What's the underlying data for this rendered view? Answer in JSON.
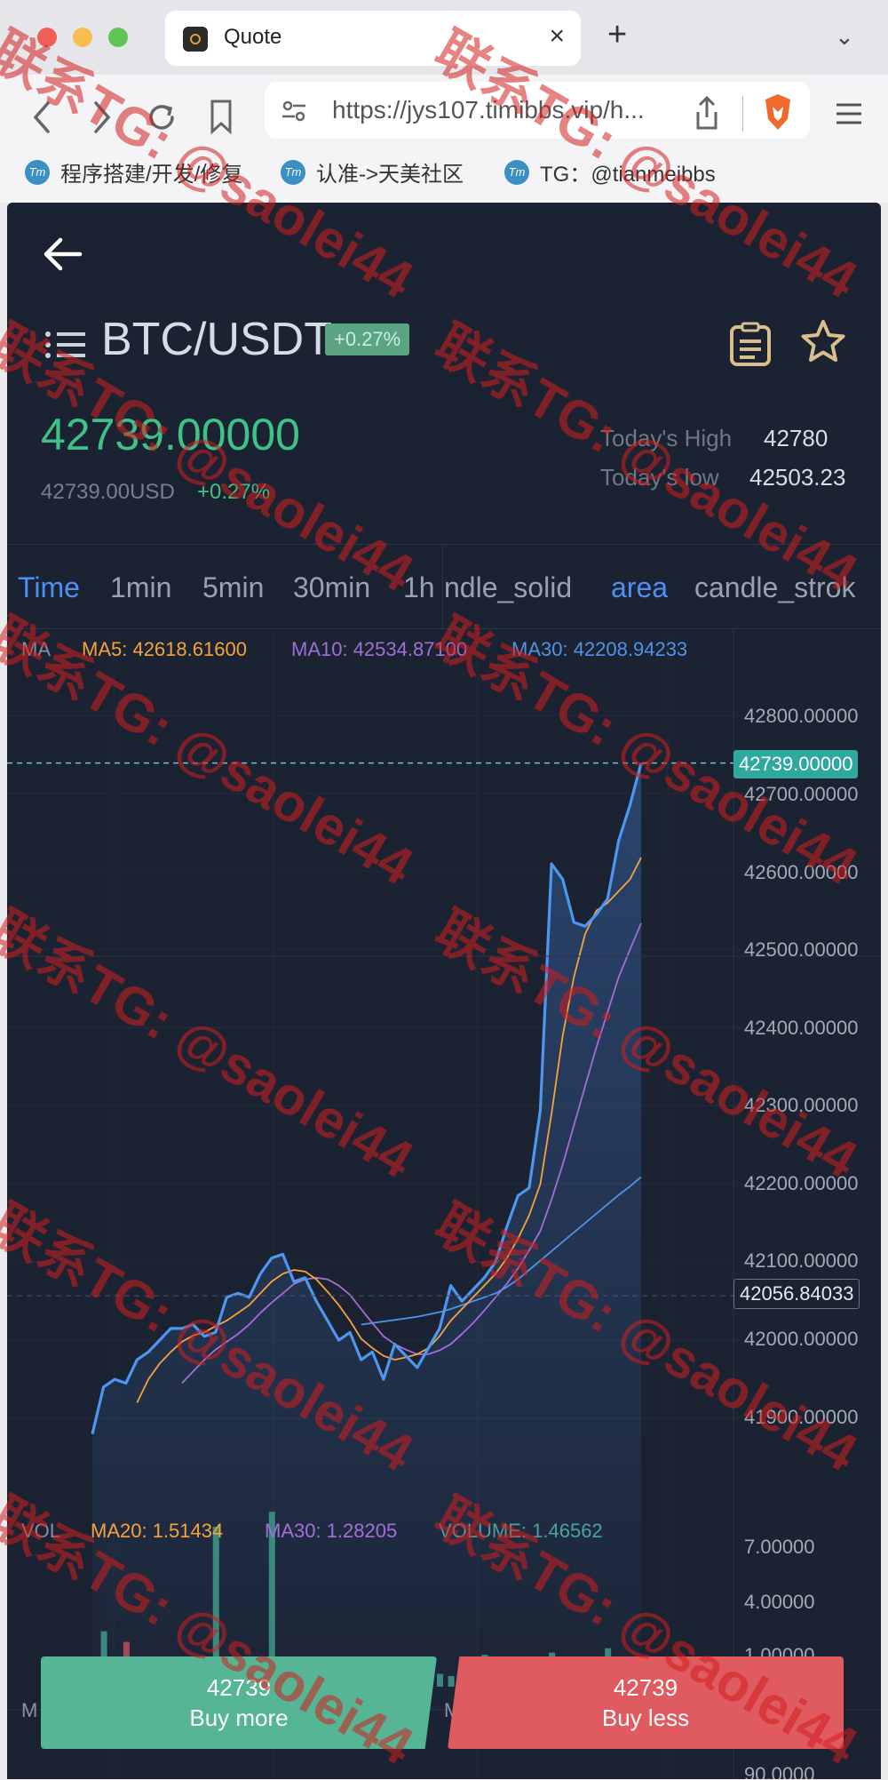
{
  "browser": {
    "tab_title": "Quote",
    "tab_close": "×",
    "new_tab": "+",
    "url": "https://jys107.timibbs.vip/h...",
    "bookmarks": [
      {
        "icon": "Tm",
        "label": "程序搭建/开发/修复"
      },
      {
        "icon": "Tm",
        "label": "认准->天美社区"
      },
      {
        "icon": "Tm",
        "label": "TG：@tianmeibbs"
      }
    ],
    "colors": {
      "close": "#ef5f57",
      "minimize": "#f5be4f",
      "maximize": "#5fc554"
    }
  },
  "header": {
    "pair": "BTC/USDT",
    "change_badge": "+0.27%",
    "price": "42739.00000",
    "price_usd": "42739.00USD",
    "change": "+0.27%",
    "high_label": "Today's High",
    "high_value": "42780",
    "low_label": "Today's low",
    "low_value": "42503.23"
  },
  "timeframes": [
    "Time",
    "1min",
    "5min",
    "30min",
    "1h",
    "ndle_solid",
    "area",
    "candle_strok"
  ],
  "main_legend": {
    "label": "MA",
    "ma5": "MA5: 42618.61600",
    "ma10": "MA10: 42534.87100",
    "ma30": "MA30: 42208.94233"
  },
  "vol_legend": {
    "label": "VOL",
    "ma20": "MA20: 1.51434",
    "ma30": "MA30: 1.28205",
    "volume": "VOLUME: 1.46562"
  },
  "third_pane_label": "M",
  "third_pane_label2": "M",
  "price_axis": [
    "42800.00000",
    "42700.00000",
    "42600.00000",
    "42500.00000",
    "42400.00000",
    "42300.00000",
    "42200.00000",
    "42100.00000",
    "42000.00000",
    "41900.00000"
  ],
  "vol_axis": [
    "7.00000",
    "4.00000",
    "1.00000"
  ],
  "bottom_axis": "90.0000",
  "last_price_tag": "42739.00000",
  "cursor_price_tag": "42056.84033",
  "buttons": {
    "buy_price": "42739",
    "buy_label": "Buy more",
    "sell_price": "42739",
    "sell_label": "Buy less"
  },
  "watermark": "联系TG: @saolei44",
  "chart_data": {
    "type": "line",
    "ylim": [
      41900,
      42800
    ],
    "price": [
      41880,
      41940,
      41950,
      41945,
      41975,
      41985,
      42000,
      42015,
      42015,
      42020,
      42005,
      42010,
      42055,
      42060,
      42055,
      42085,
      42105,
      42110,
      42075,
      42080,
      42050,
      42025,
      42000,
      42010,
      41975,
      41985,
      41950,
      41995,
      41980,
      41965,
      41990,
      42015,
      42070,
      42050,
      42065,
      42080,
      42100,
      42145,
      42185,
      42195,
      42295,
      42610,
      42590,
      42535,
      42530,
      42545,
      42565,
      42640,
      42685,
      42739
    ],
    "ma5": [
      null,
      null,
      null,
      null,
      41920,
      41950,
      41970,
      41985,
      41998,
      42006,
      42010,
      42018,
      42025,
      42035,
      42045,
      42060,
      42075,
      42085,
      42090,
      42088,
      42078,
      42062,
      42045,
      42025,
      42002,
      41990,
      41980,
      41975,
      41978,
      41982,
      41990,
      42005,
      42025,
      42040,
      42055,
      42070,
      42085,
      42105,
      42130,
      42160,
      42200,
      42290,
      42390,
      42465,
      42520,
      42550,
      42560,
      42575,
      42590,
      42618
    ],
    "ma10": [
      null,
      null,
      null,
      null,
      null,
      null,
      null,
      null,
      41945,
      41960,
      41975,
      41988,
      41998,
      42008,
      42020,
      42035,
      42048,
      42060,
      42072,
      42078,
      42080,
      42078,
      42070,
      42058,
      42040,
      42022,
      42005,
      41995,
      41988,
      41982,
      41982,
      41987,
      41995,
      42008,
      42022,
      42038,
      42055,
      42072,
      42092,
      42115,
      42140,
      42180,
      42225,
      42275,
      42325,
      42375,
      42420,
      42465,
      42500,
      42534
    ],
    "ma30": [
      null,
      null,
      null,
      null,
      null,
      null,
      null,
      null,
      null,
      null,
      null,
      null,
      null,
      null,
      null,
      null,
      null,
      null,
      null,
      null,
      null,
      null,
      null,
      null,
      42020,
      42022,
      42024,
      42026,
      42028,
      42030,
      42033,
      42036,
      42040,
      42045,
      42050,
      42055,
      42060,
      42068,
      42078,
      42090,
      42102,
      42114,
      42126,
      42138,
      42150,
      42162,
      42174,
      42186,
      42197,
      42209
    ]
  }
}
